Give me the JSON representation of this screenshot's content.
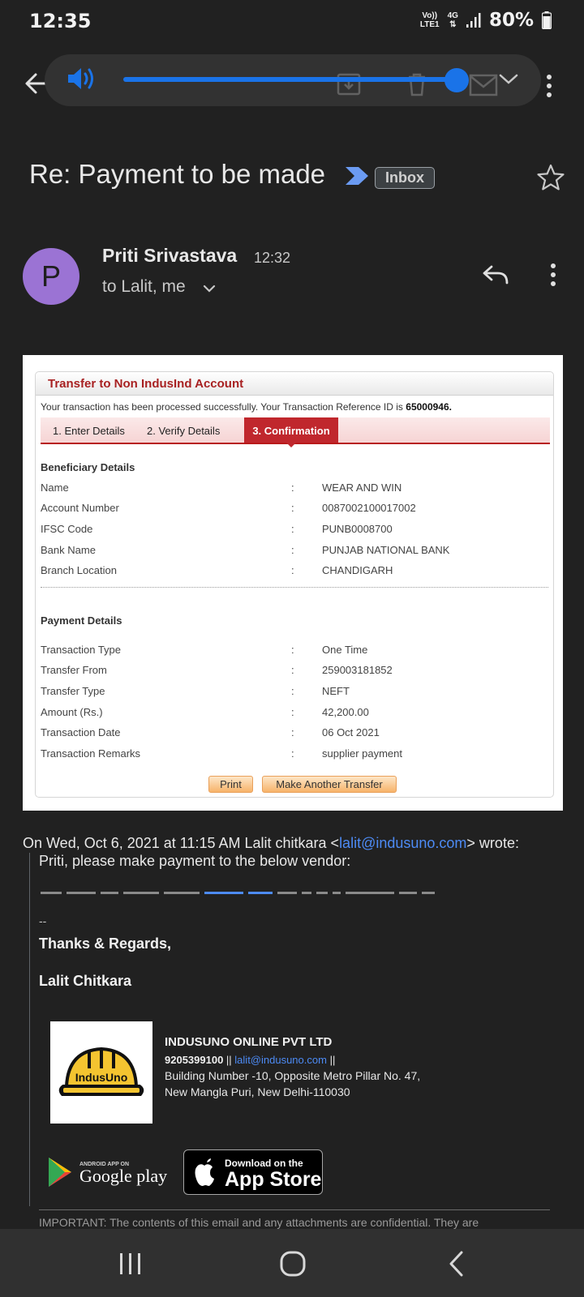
{
  "status_bar": {
    "time": "12:35",
    "carrier_top": "Vo))",
    "carrier_bottom": "LTE1",
    "network": "4G",
    "battery": "80%"
  },
  "volume": {
    "level_fraction": 0.97,
    "accent_color": "#1a73e8"
  },
  "email": {
    "subject": "Re: Payment to be made",
    "label": "Inbox",
    "sender_initial": "P",
    "sender_name": "Priti Srivastava",
    "time": "12:32",
    "recipients": "to Lalit, me",
    "avatar_color": "#9b73d4"
  },
  "bank_screenshot": {
    "title": "Transfer to Non IndusInd Account",
    "success_text": "Your transaction has been processed successfully. Your Transaction Reference ID is ",
    "reference_id": "65000946.",
    "tabs": [
      "1. Enter Details",
      "2. Verify Details",
      "3. Confirmation"
    ],
    "beneficiary_heading": "Beneficiary Details",
    "beneficiary": [
      {
        "label": "Name",
        "value": "WEAR AND WIN"
      },
      {
        "label": "Account Number",
        "value": "0087002100017002"
      },
      {
        "label": "IFSC Code",
        "value": "PUNB0008700"
      },
      {
        "label": "Bank Name",
        "value": "PUNJAB NATIONAL BANK"
      },
      {
        "label": "Branch Location",
        "value": "CHANDIGARH"
      }
    ],
    "payment_heading": "Payment Details",
    "payment": [
      {
        "label": "Transaction Type",
        "value": "One Time"
      },
      {
        "label": "Transfer From",
        "value": "259003181852"
      },
      {
        "label": "Transfer Type",
        "value": "NEFT"
      },
      {
        "label": "Amount (Rs.)",
        "value": "42,200.00"
      },
      {
        "label": "Transaction Date",
        "value": "06 Oct 2021"
      },
      {
        "label": "Transaction Remarks",
        "value": "supplier payment"
      }
    ],
    "separator": ":",
    "print_button": "Print",
    "another_button": "Make Another Transfer"
  },
  "quote": {
    "header_prefix": "On Wed, Oct 6, 2021 at 11:15 AM Lalit chitkara <",
    "header_email": "lalit@indusuno.com",
    "header_suffix": "> wrote:",
    "body": "Priti, please make payment to the below vendor:",
    "sig_dash": "--",
    "thanks": "Thanks & Regards,",
    "name": "Lalit Chitkara",
    "logo_text": "IndusUno",
    "company": "INDUSUNO ONLINE PVT LTD",
    "phone": "9205399100",
    "contact_sep1": " || ",
    "contact_email": "lalit@indusuno.com",
    "contact_sep2": " ||",
    "address_line1": "Building Number -10, Opposite  Metro Pillar No. 47,",
    "address_line2": "New Mangla Puri, New Delhi-110030",
    "google_small": "ANDROID APP ON",
    "google_big": "Google play",
    "apple_small": "Download on the",
    "apple_big": "App Store",
    "disclaimer": "IMPORTANT: The contents of this email and any attachments are confidential. They are"
  }
}
